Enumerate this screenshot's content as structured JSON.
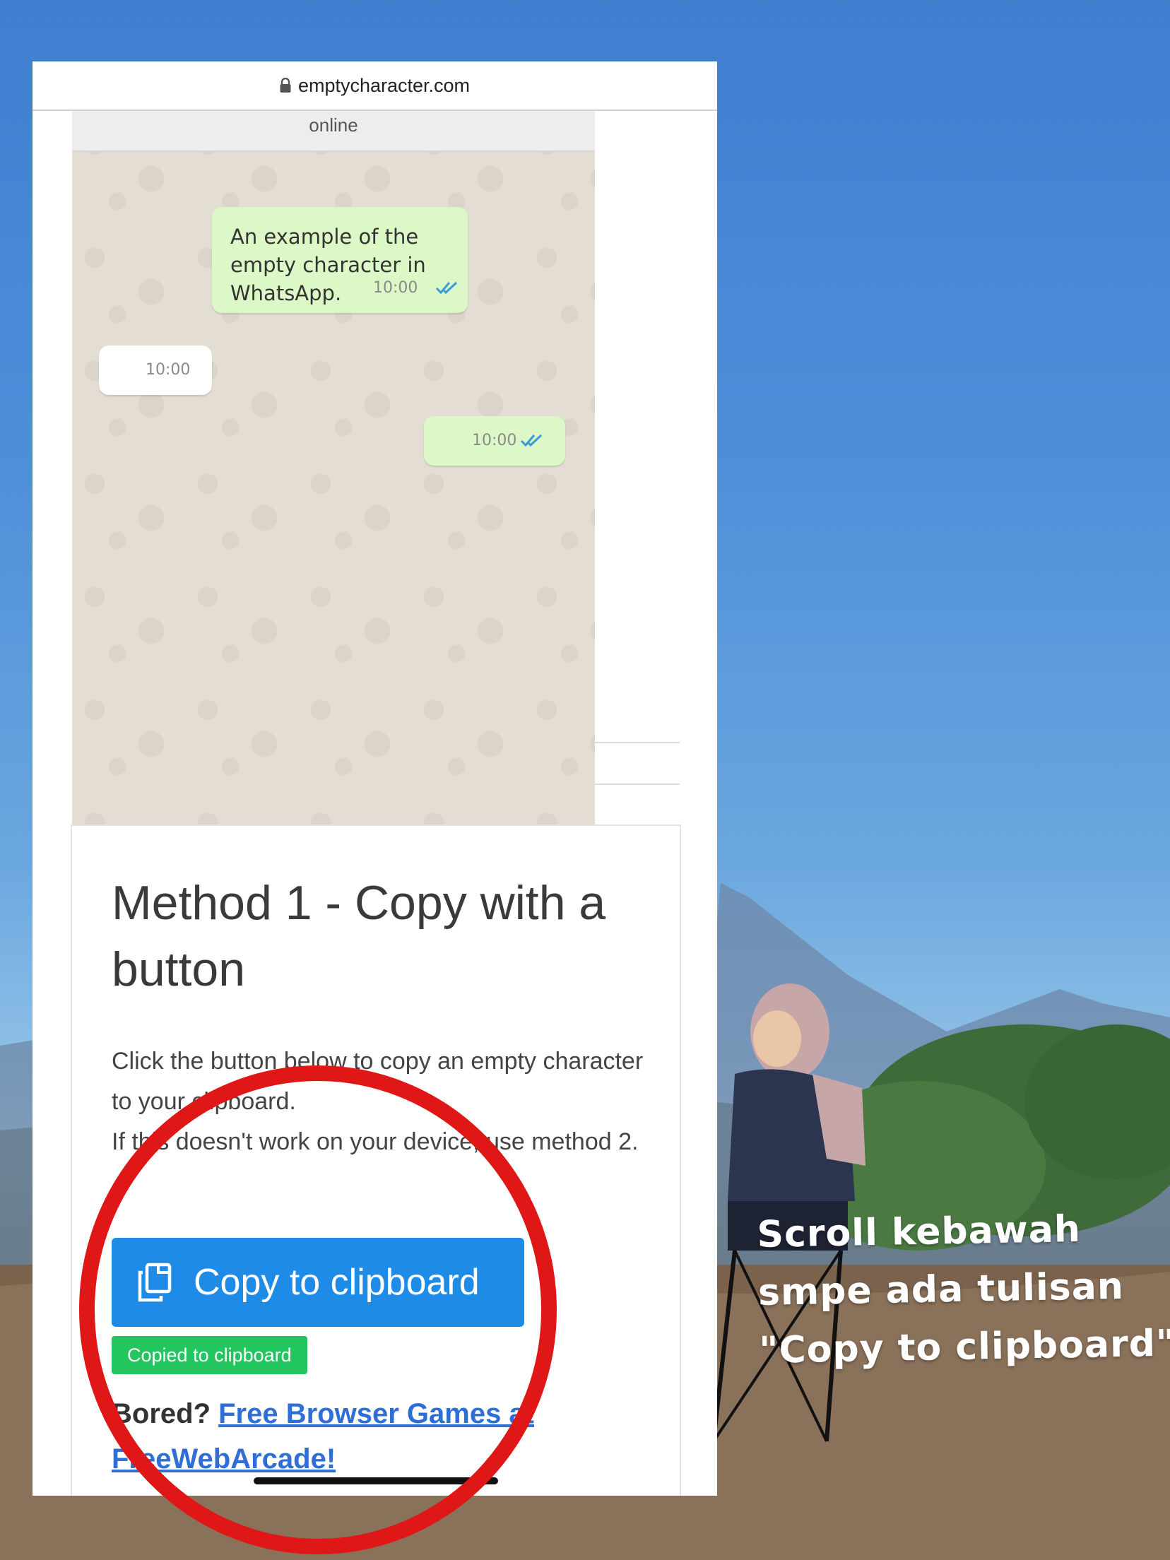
{
  "browser": {
    "url": "emptycharacter.com"
  },
  "chat": {
    "header_status": "online",
    "messages": [
      {
        "text": "An example of the empty character in WhatsApp.",
        "time": "10:00"
      },
      {
        "time": "10:00"
      },
      {
        "time": "10:00"
      }
    ]
  },
  "card": {
    "title": "Method 1 - Copy with a button",
    "desc_line1": "Click the button below to copy an empty character to your clipboard.",
    "desc_line2": "If this doesn't work on your device, use method 2.",
    "copy_button_label": "Copy to clipboard",
    "copied_badge": "Copied to clipboard",
    "bored_prefix": "Bored?",
    "bored_link": "Free Browser Games at FreeWebArcade!"
  },
  "overlay": {
    "caption_line1": "Scroll kebawah",
    "caption_line2": "smpe ada tulisan",
    "caption_line3": "\"Copy to clipboard\""
  },
  "colors": {
    "accent_button": "#1e8ce6",
    "success_badge": "#22c55e",
    "annotation_circle": "#e01717",
    "outgoing_bubble": "#dcf8c6"
  }
}
